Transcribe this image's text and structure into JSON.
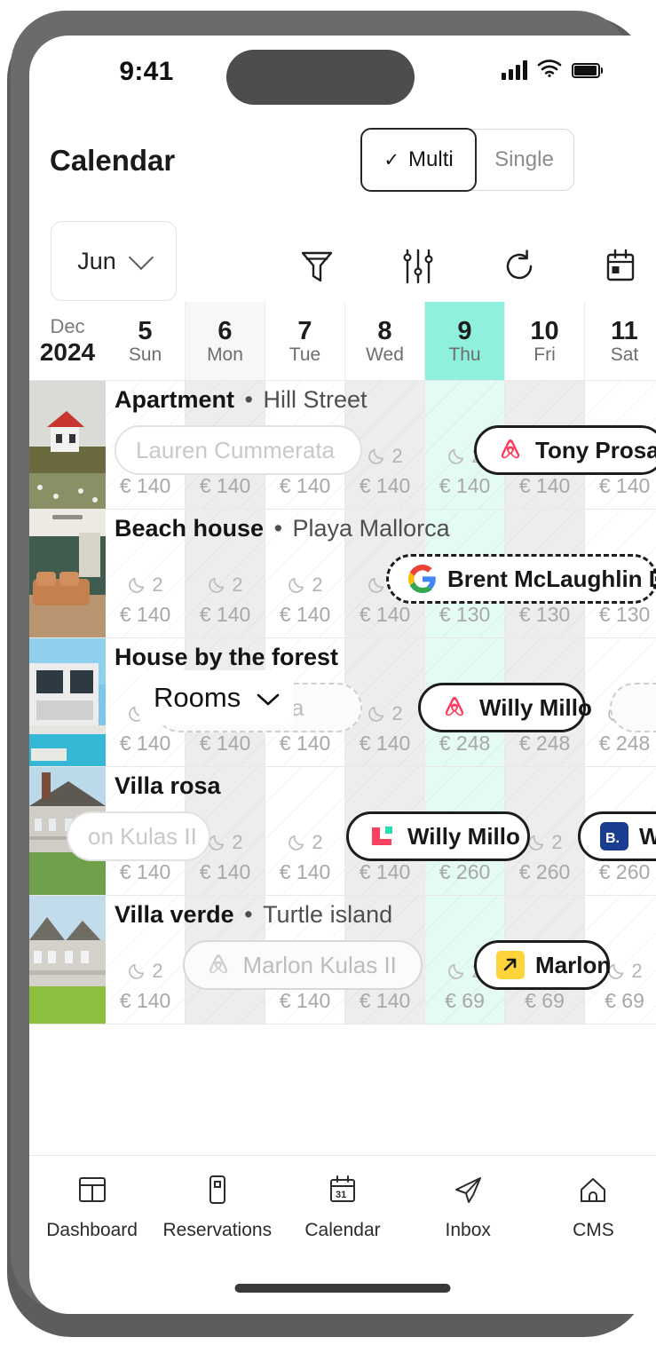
{
  "status_bar": {
    "time": "9:41",
    "signal_icon": "cellular-signal-icon",
    "wifi_icon": "wifi-icon",
    "battery_icon": "battery-icon"
  },
  "header": {
    "title": "Calendar",
    "view_toggle": {
      "options": [
        {
          "label": "Multi",
          "selected": true,
          "check_icon": "check-icon"
        },
        {
          "label": "Single",
          "selected": false
        }
      ]
    }
  },
  "toolbar": {
    "month": "Jun",
    "month_chevron_icon": "chevron-down-icon",
    "icons": [
      {
        "name": "filter-icon",
        "label": "Filter"
      },
      {
        "name": "sliders-icon",
        "label": "Settings"
      },
      {
        "name": "refresh-icon",
        "label": "Refresh"
      },
      {
        "name": "calendar-icon",
        "label": "Date picker"
      }
    ]
  },
  "calendar": {
    "corner": {
      "month": "Dec",
      "year": "2024"
    },
    "days": [
      {
        "num": "5",
        "dow": "Sun",
        "today": false,
        "alt": false
      },
      {
        "num": "6",
        "dow": "Mon",
        "today": false,
        "alt": true
      },
      {
        "num": "7",
        "dow": "Tue",
        "today": false,
        "alt": false
      },
      {
        "num": "8",
        "dow": "Wed",
        "today": false,
        "alt": false
      },
      {
        "num": "9",
        "dow": "Thu",
        "today": true,
        "alt": false
      },
      {
        "num": "10",
        "dow": "Fri",
        "today": false,
        "alt": false
      },
      {
        "num": "11",
        "dow": "Sat",
        "today": false,
        "alt": false
      }
    ],
    "nights_label": "2",
    "moon_icon": "moon-icon",
    "rooms_dropdown": {
      "label": "Rooms",
      "chevron_icon": "chevron-down-icon"
    },
    "rows": [
      {
        "title_bold": "Apartment",
        "title_sep": "•",
        "title_rest": "Hill Street",
        "thumb": "red-house-thumbnail",
        "prices": [
          "€ 140",
          "€ 140",
          "€ 140",
          "€ 140",
          "€ 140",
          "€ 140",
          "€ 140"
        ],
        "bookings": [
          {
            "name": "Lauren Cummerata",
            "style": "plain-ghost",
            "logo": "none",
            "start": 0,
            "span": 3.1
          },
          {
            "name": "Tony Prosacco",
            "style": "solid",
            "logo": "airbnb",
            "start": 4.5,
            "span": 2.4
          }
        ]
      },
      {
        "title_bold": "Beach house",
        "title_sep": "•",
        "title_rest": "Playa Mallorca",
        "thumb": "living-room-thumbnail",
        "prices": [
          "€ 140",
          "€ 140",
          "€ 140",
          "€ 140",
          "€ 130",
          "€ 130",
          "€ 130"
        ],
        "bookings": [
          {
            "name": "Brent McLaughlin DDS",
            "style": "dash-dark",
            "logo": "google",
            "start": 3.4,
            "span": 3.4
          }
        ]
      },
      {
        "title_bold": "House by the forest",
        "title_sep": "",
        "title_rest": "",
        "thumb": "modern-villa-pool-thumbnail",
        "prices": [
          "€ 140",
          "€ 140",
          "€ 140",
          "€ 140",
          "€ 248",
          "€ 248",
          "€ 248"
        ],
        "bookings": [
          {
            "name": "maria téresa",
            "style": "ghost-dash",
            "logo": "none",
            "start": 0.5,
            "span": 2.6
          },
          {
            "name": "Willy Millo",
            "style": "solid",
            "logo": "airbnb",
            "start": 3.8,
            "span": 2.1
          },
          {
            "name": "",
            "style": "ghost-dash",
            "logo": "none",
            "start": 6.2,
            "span": 1.2
          }
        ]
      },
      {
        "title_bold": "Villa rosa",
        "title_sep": "",
        "title_rest": "",
        "thumb": "white-house-lawn-thumbnail",
        "prices": [
          "€ 140",
          "€ 140",
          "€ 140",
          "€ 140",
          "€ 260",
          "€ 260",
          "€ 260"
        ],
        "bookings": [
          {
            "name": "on Kulas II",
            "style": "plain-ghost",
            "logo": "none",
            "start": -0.6,
            "span": 1.8
          },
          {
            "name": "Willy Millo",
            "style": "solid",
            "logo": "vrbo",
            "start": 2.9,
            "span": 2.3
          },
          {
            "name": "Willy",
            "style": "solid",
            "logo": "booking",
            "start": 5.8,
            "span": 2.0
          }
        ]
      },
      {
        "title_bold": "Villa verde",
        "title_sep": "•",
        "title_rest": "Turtle island",
        "thumb": "grey-mansion-thumbnail",
        "prices": [
          "€ 140",
          "",
          "€ 140",
          "€ 140",
          "€ 69",
          "€ 69",
          "€ 69"
        ],
        "bookings": [
          {
            "name": "Marlon Kulas II",
            "style": "ghost",
            "logo": "airbnb-ghost",
            "start": 0.85,
            "span": 3.0
          },
          {
            "name": "Marlon",
            "style": "solid",
            "logo": "expedia",
            "start": 4.5,
            "span": 1.7
          }
        ]
      }
    ]
  },
  "bottom_nav": {
    "items": [
      {
        "label": "Dashboard",
        "icon": "dashboard-icon",
        "active": false
      },
      {
        "label": "Reservations",
        "icon": "reservations-icon",
        "active": false
      },
      {
        "label": "Calendar",
        "icon": "calendar-31-icon",
        "active": true
      },
      {
        "label": "Inbox",
        "icon": "paper-plane-icon",
        "active": false
      },
      {
        "label": "CMS",
        "icon": "home-icon",
        "active": false
      }
    ]
  },
  "colors": {
    "today_header": "#8ff0dd",
    "today_cell": "#e3faf5",
    "airbnb": "#FF385C",
    "vrbo_red": "#F9425F",
    "vrbo_teal": "#22E0B1",
    "booking_blue": "#1A3D8F",
    "expedia_yellow": "#FFD43A",
    "text_primary": "#1a1a1a",
    "text_muted": "#a8a8a8"
  }
}
